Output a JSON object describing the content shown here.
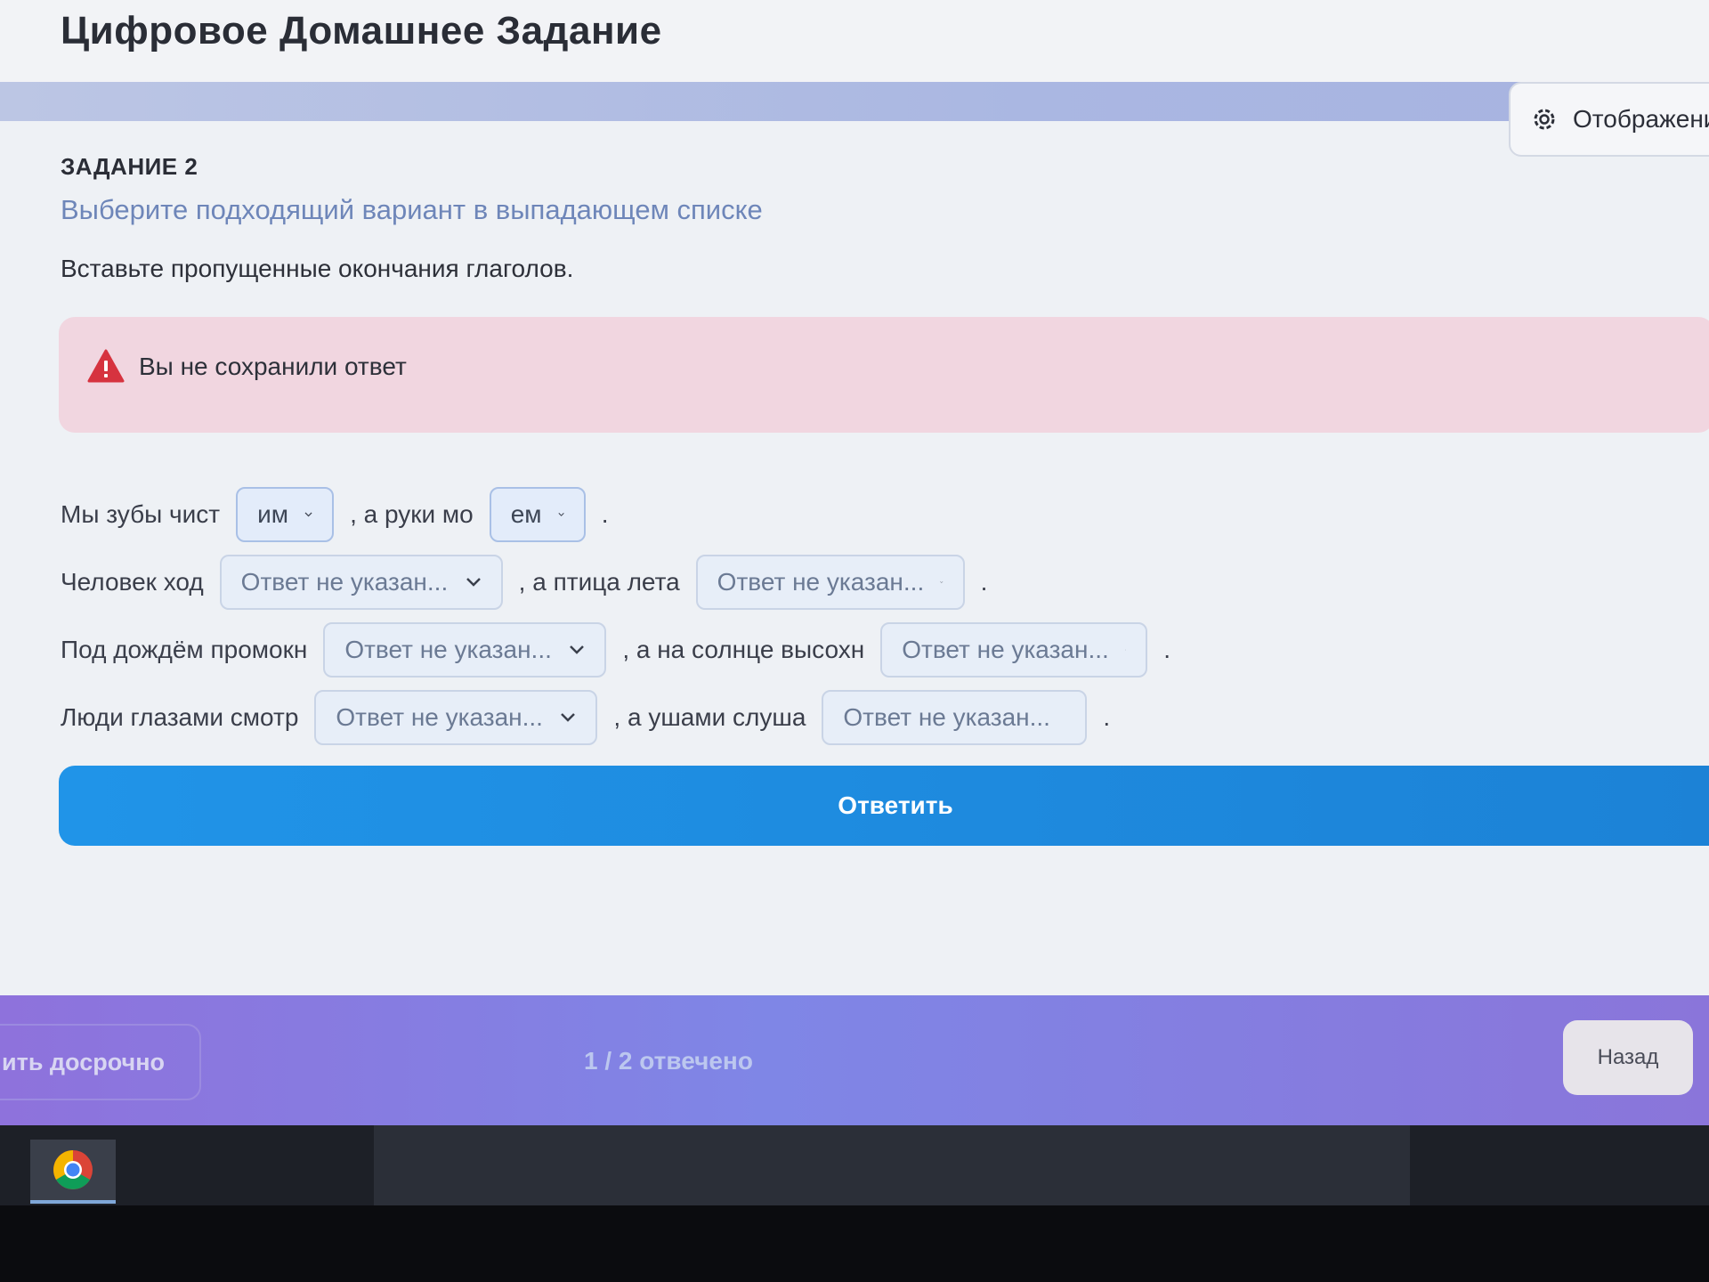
{
  "header": {
    "title": "Цифровое Домашнее Задание",
    "display_label": "Отображение"
  },
  "task": {
    "number": "ЗАДАНИЕ 2",
    "type": "Выберите подходящий вариант в выпадающем списке",
    "instruction": "Вставьте пропущенные окончания глаголов."
  },
  "alert": {
    "text": "Вы не сохранили ответ"
  },
  "rows": [
    {
      "part1": "Мы зубы чист",
      "select1": "им",
      "part2": ", а руки мо",
      "select2": "ем",
      "end": "."
    },
    {
      "part1": "Человек ход",
      "select1": "Ответ не указан...",
      "part2": ", а птица лета",
      "select2": "Ответ не указан...",
      "end": "."
    },
    {
      "part1": "Под дождём промокн",
      "select1": "Ответ не указан...",
      "part2": ", а на солнце высохн",
      "select2": "Ответ не указан...",
      "end": "."
    },
    {
      "part1": "Люди глазами смотр",
      "select1": "Ответ не указан...",
      "part2": ", а ушами слуша",
      "select2": "Ответ не указан...",
      "end": "."
    }
  ],
  "submit_label": "Ответить",
  "footer": {
    "finish_label": "ить досрочно",
    "progress": "1 / 2 отвечено",
    "back_label": "Назад"
  },
  "colors": {
    "accent": "#1e8fe5",
    "alert_bg": "#f1d6e0",
    "footer": "#7f86e6"
  },
  "taskbar": {
    "pinned_app": "chrome-icon"
  }
}
